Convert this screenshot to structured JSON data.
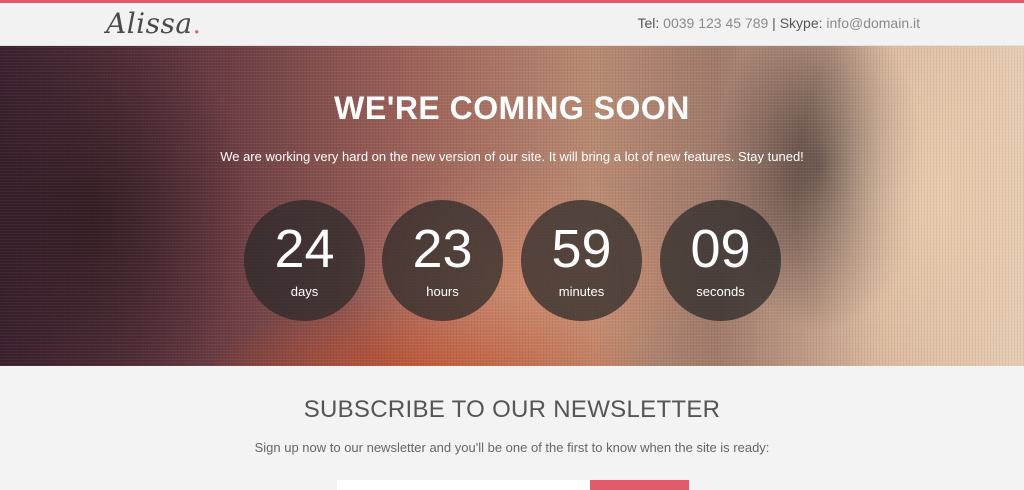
{
  "header": {
    "logo_text": "Alissa",
    "logo_dot": ".",
    "tel_label": "Tel:",
    "tel_value": "0039 123 45 789",
    "separator": "|",
    "skype_label": "Skype:",
    "skype_value": "info@domain.it"
  },
  "hero": {
    "title": "WE'RE COMING SOON",
    "subtitle": "We are working very hard on the new version of our site. It will bring a lot of new features. Stay tuned!",
    "countdown": [
      {
        "value": "24",
        "unit": "days"
      },
      {
        "value": "23",
        "unit": "hours"
      },
      {
        "value": "59",
        "unit": "minutes"
      },
      {
        "value": "09",
        "unit": "seconds"
      }
    ]
  },
  "newsletter": {
    "title": "SUBSCRIBE TO OUR NEWSLETTER",
    "text": "Sign up now to our newsletter and you'll be one of the first to know when the site is ready:"
  },
  "colors": {
    "accent": "#e35b6a"
  }
}
